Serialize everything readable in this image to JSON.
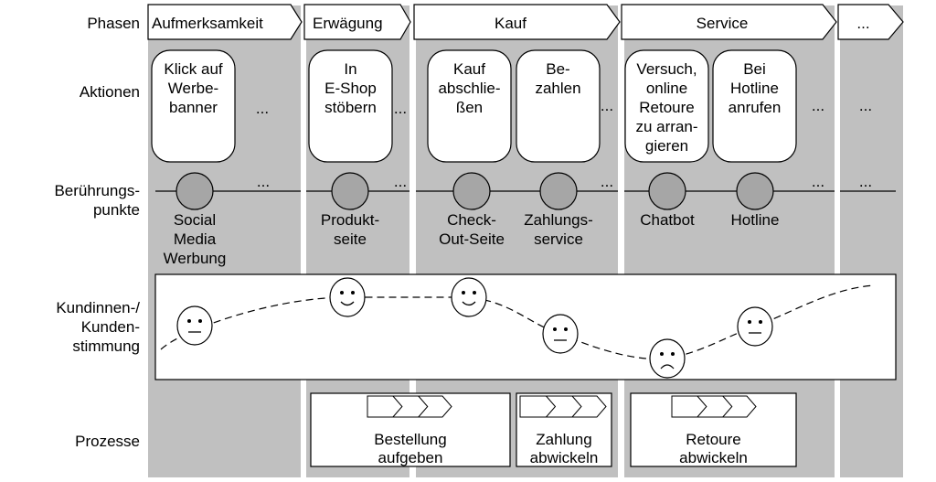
{
  "colors": {
    "lane": "#c0c0c0",
    "touchpoint": "#a6a6a6",
    "stroke": "#000000",
    "box": "#ffffff"
  },
  "row_labels": {
    "phases": [
      "Phasen"
    ],
    "actions": [
      "Aktionen"
    ],
    "touchpoints": [
      "Berührungs-",
      "punkte"
    ],
    "mood": [
      "Kundinnen-/",
      "Kunden-",
      "stimmung"
    ],
    "processes": [
      "Prozesse"
    ]
  },
  "phases": [
    {
      "label": "Aufmerksamkeit"
    },
    {
      "label": "Erwägung"
    },
    {
      "label": "Kauf"
    },
    {
      "label": "Service"
    },
    {
      "label": "..."
    }
  ],
  "actions": [
    {
      "lines": [
        "Klick auf",
        "Werbe-",
        "banner"
      ]
    },
    {
      "lines": [
        "In",
        "E-Shop",
        "stöbern"
      ]
    },
    {
      "lines": [
        "Kauf",
        "abschlie-",
        "ßen"
      ]
    },
    {
      "lines": [
        "Be-",
        "zahlen"
      ]
    },
    {
      "lines": [
        "Versuch,",
        "online",
        "Retoure",
        "zu arran-",
        "gieren"
      ]
    },
    {
      "lines": [
        "Bei",
        "Hotline",
        "anrufen"
      ]
    }
  ],
  "ellipsis": "...",
  "touchpoints": [
    {
      "lines": [
        "Social",
        "Media",
        "Werbung"
      ]
    },
    {
      "lines": [
        "Produkt-",
        "seite"
      ]
    },
    {
      "lines": [
        "Check-",
        "Out-Seite"
      ]
    },
    {
      "lines": [
        "Zahlungs-",
        "service"
      ]
    },
    {
      "lines": [
        "Chatbot"
      ]
    },
    {
      "lines": [
        "Hotline"
      ]
    }
  ],
  "mood_faces": [
    "neutral",
    "happy",
    "happy",
    "neutral",
    "sad",
    "neutral"
  ],
  "processes": [
    {
      "lines": [
        "Bestellung",
        "aufgeben"
      ]
    },
    {
      "lines": [
        "Zahlung",
        "abwickeln"
      ]
    },
    {
      "lines": [
        "Retoure",
        "abwickeln"
      ]
    }
  ]
}
